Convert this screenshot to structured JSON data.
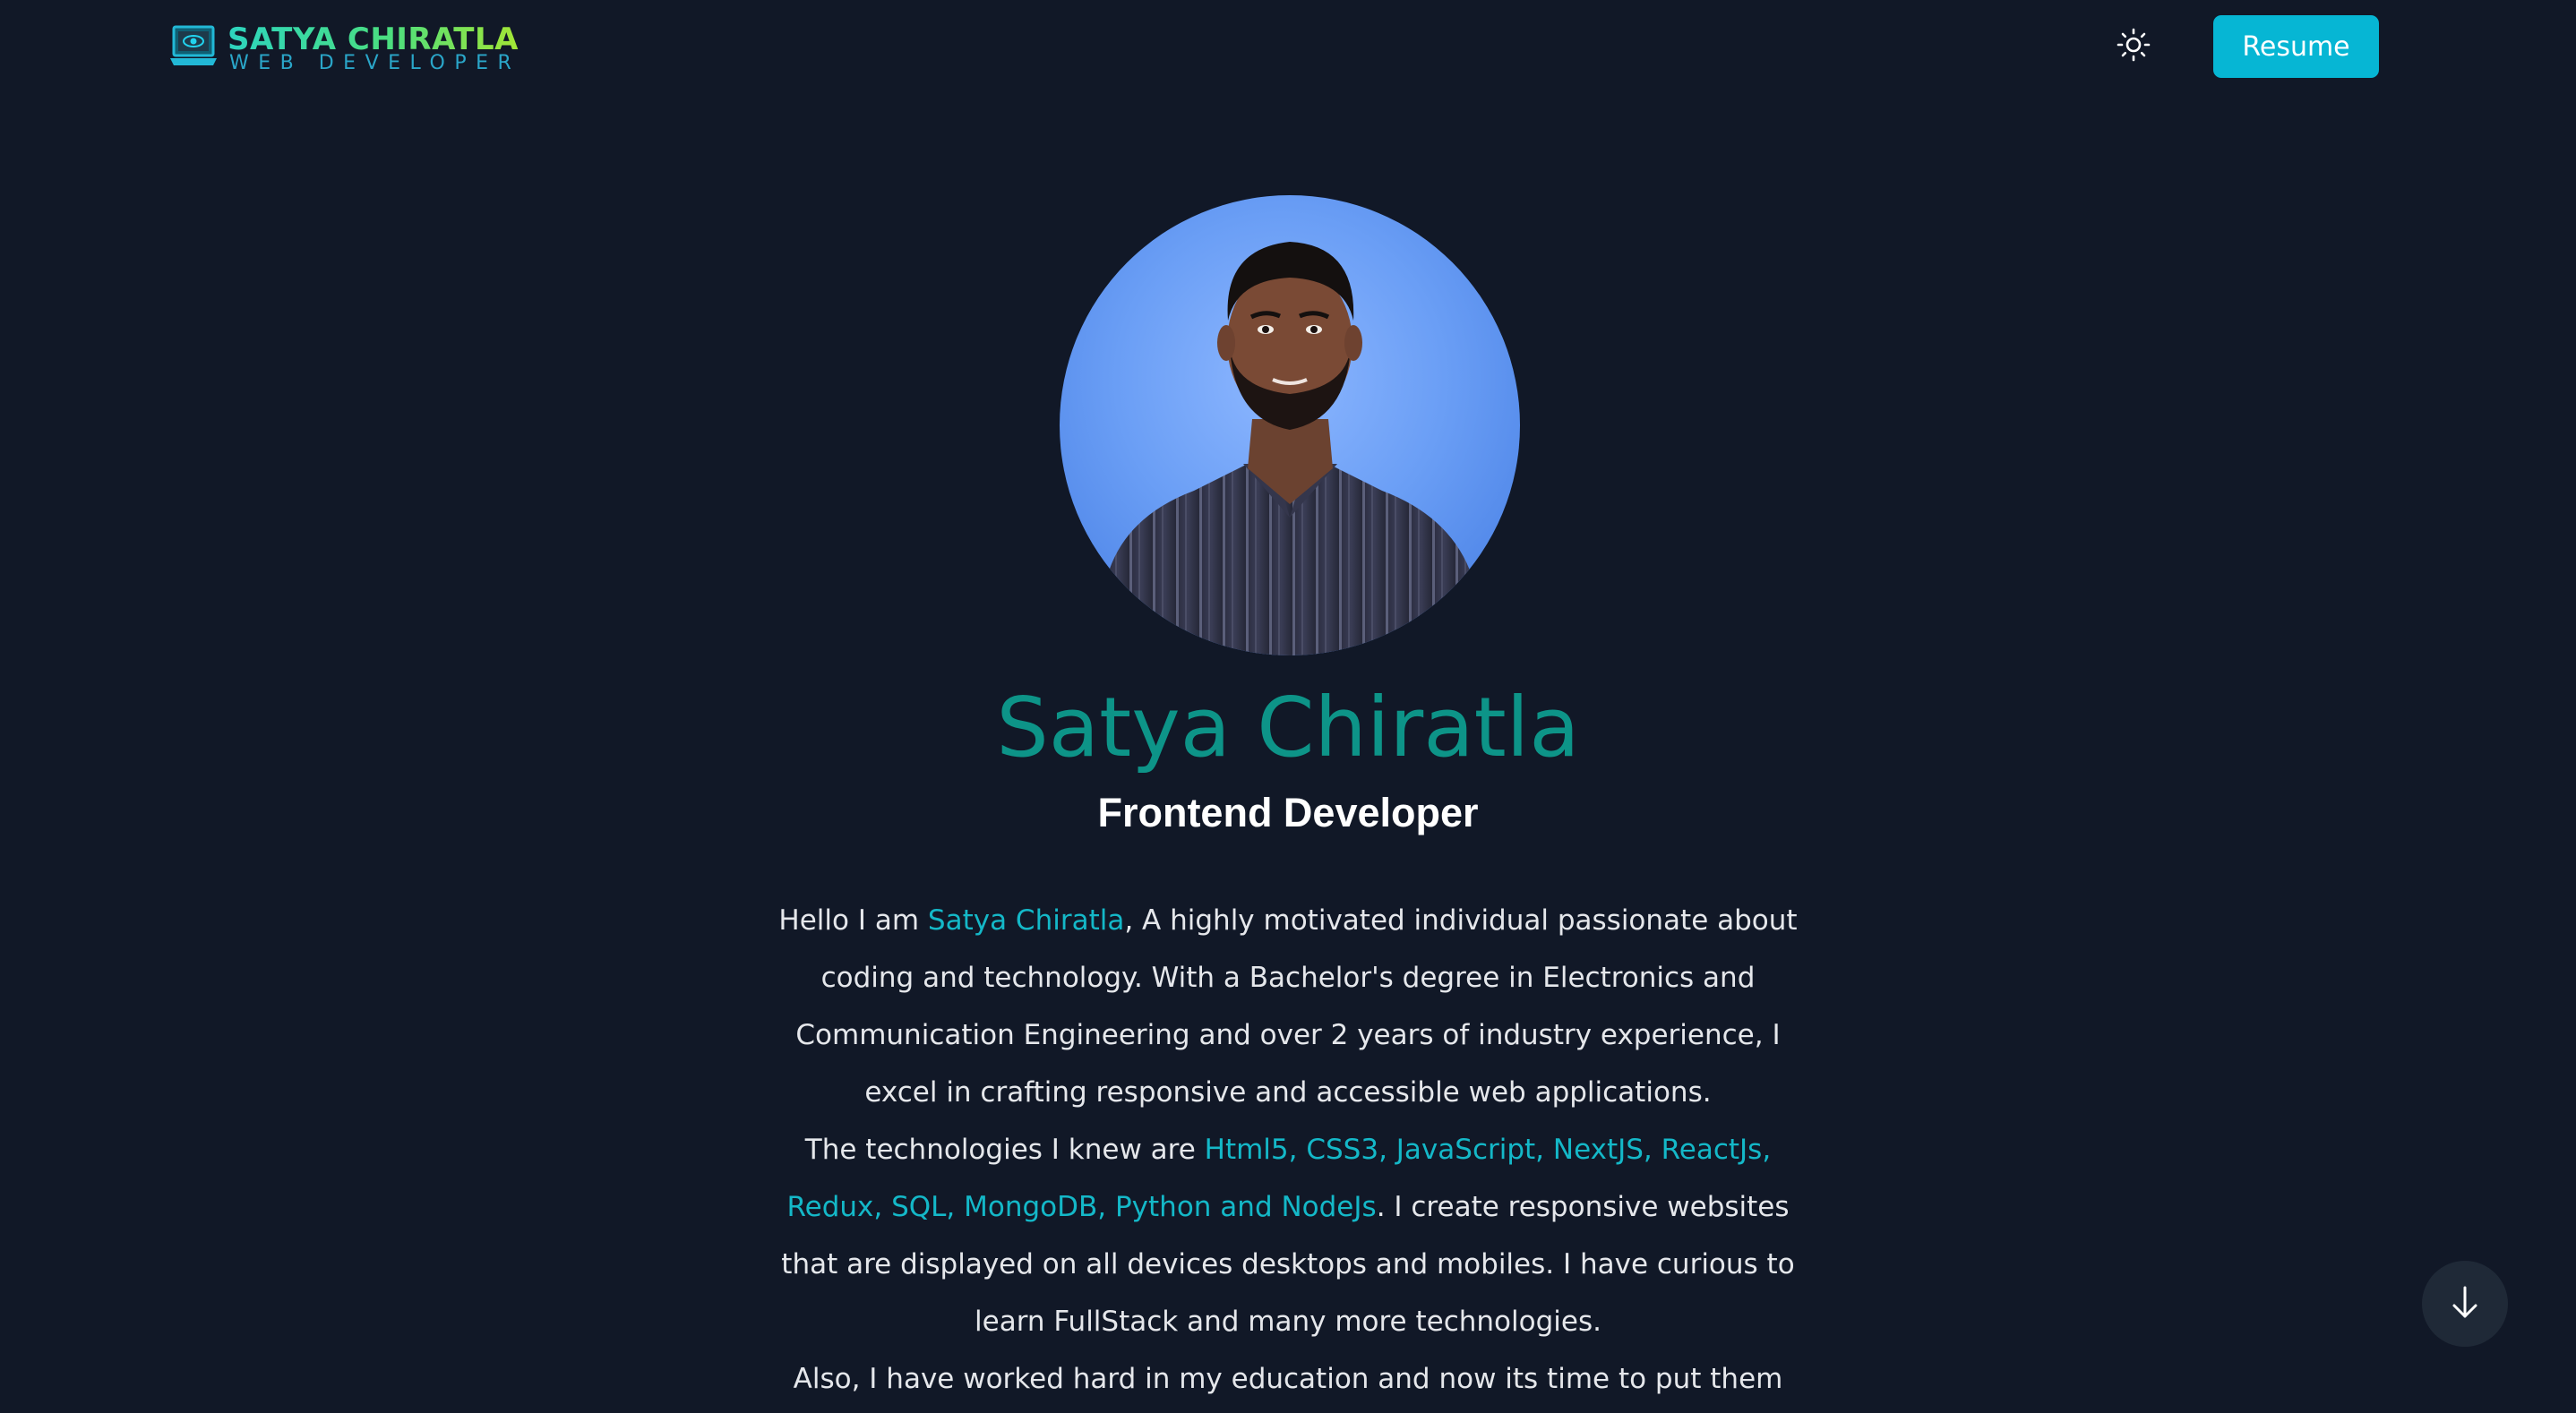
{
  "header": {
    "logo_name": "SATYA CHIRATLA",
    "logo_subtitle": "WEB DEVELOPER",
    "theme_toggle_icon": "sun-icon",
    "resume_label": "Resume"
  },
  "hero": {
    "avatar_alt": "Satya Chiratla",
    "name": "Satya Chiratla",
    "role": "Frontend Developer"
  },
  "bio": {
    "p1_prefix": "Hello I am ",
    "p1_name": "Satya Chiratla",
    "p1_suffix": ", A highly motivated individual passionate about coding and technology. With a Bachelor's degree in Electronics and Communication Engineering and over 2 years of industry experience, I excel in crafting responsive and accessible web applications.",
    "p2_prefix": "The technologies I knew are ",
    "p2_tech": "Html5, CSS3, JavaScript, NextJS, ReactJs, Redux, SQL, MongoDB, Python and NodeJs",
    "p2_suffix": ". I create responsive websites that are displayed on all devices desktops and mobiles. I have curious to learn FullStack and many more technologies.",
    "p3": "Also, I have worked hard in my education and now its time to put them into my"
  },
  "scroll_down_icon": "arrow-down-icon",
  "colors": {
    "background": "#111827",
    "accent": "#06b6d4",
    "name_teal": "#0d9488",
    "highlight": "#14b8c8"
  }
}
